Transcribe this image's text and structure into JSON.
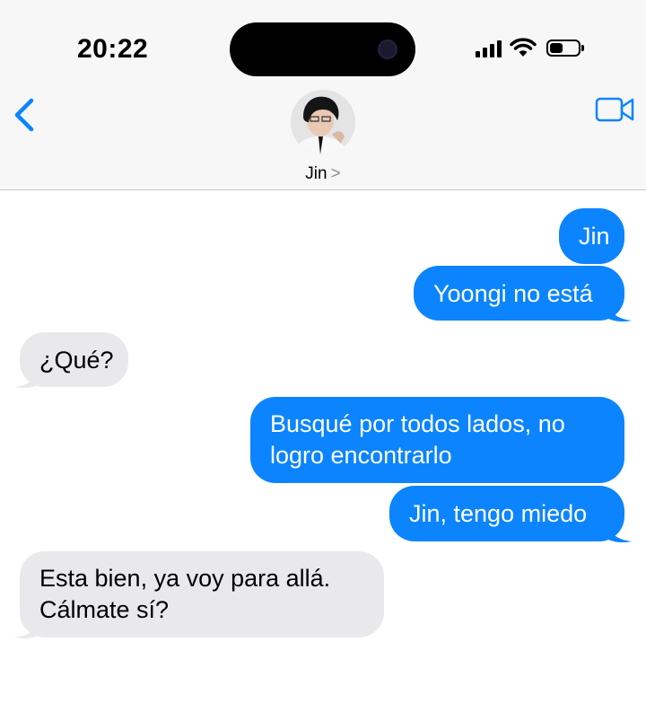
{
  "status_bar": {
    "time": "20:22",
    "signal_bars": 4,
    "battery_level": 0.45
  },
  "header": {
    "back_icon": "chevron-left-icon",
    "contact_name": "Jin",
    "contact_chevron": ">",
    "video_icon": "video-camera-icon",
    "accent_color": "#0b84fe"
  },
  "messages": [
    {
      "direction": "outgoing",
      "text": "Jin"
    },
    {
      "direction": "outgoing",
      "text": "Yoongi no está"
    },
    {
      "direction": "incoming",
      "text": "¿Qué?"
    },
    {
      "direction": "outgoing",
      "line1": "Busqué por todos lados, no",
      "line2": "logro encontrarlo"
    },
    {
      "direction": "outgoing",
      "text": "Jin, tengo miedo"
    },
    {
      "direction": "incoming",
      "line1": "Esta bien, ya voy para allá.",
      "line2": "Cálmate sí?"
    }
  ],
  "colors": {
    "outgoing_bubble": "#0b84fe",
    "incoming_bubble": "#e9e9eb"
  }
}
